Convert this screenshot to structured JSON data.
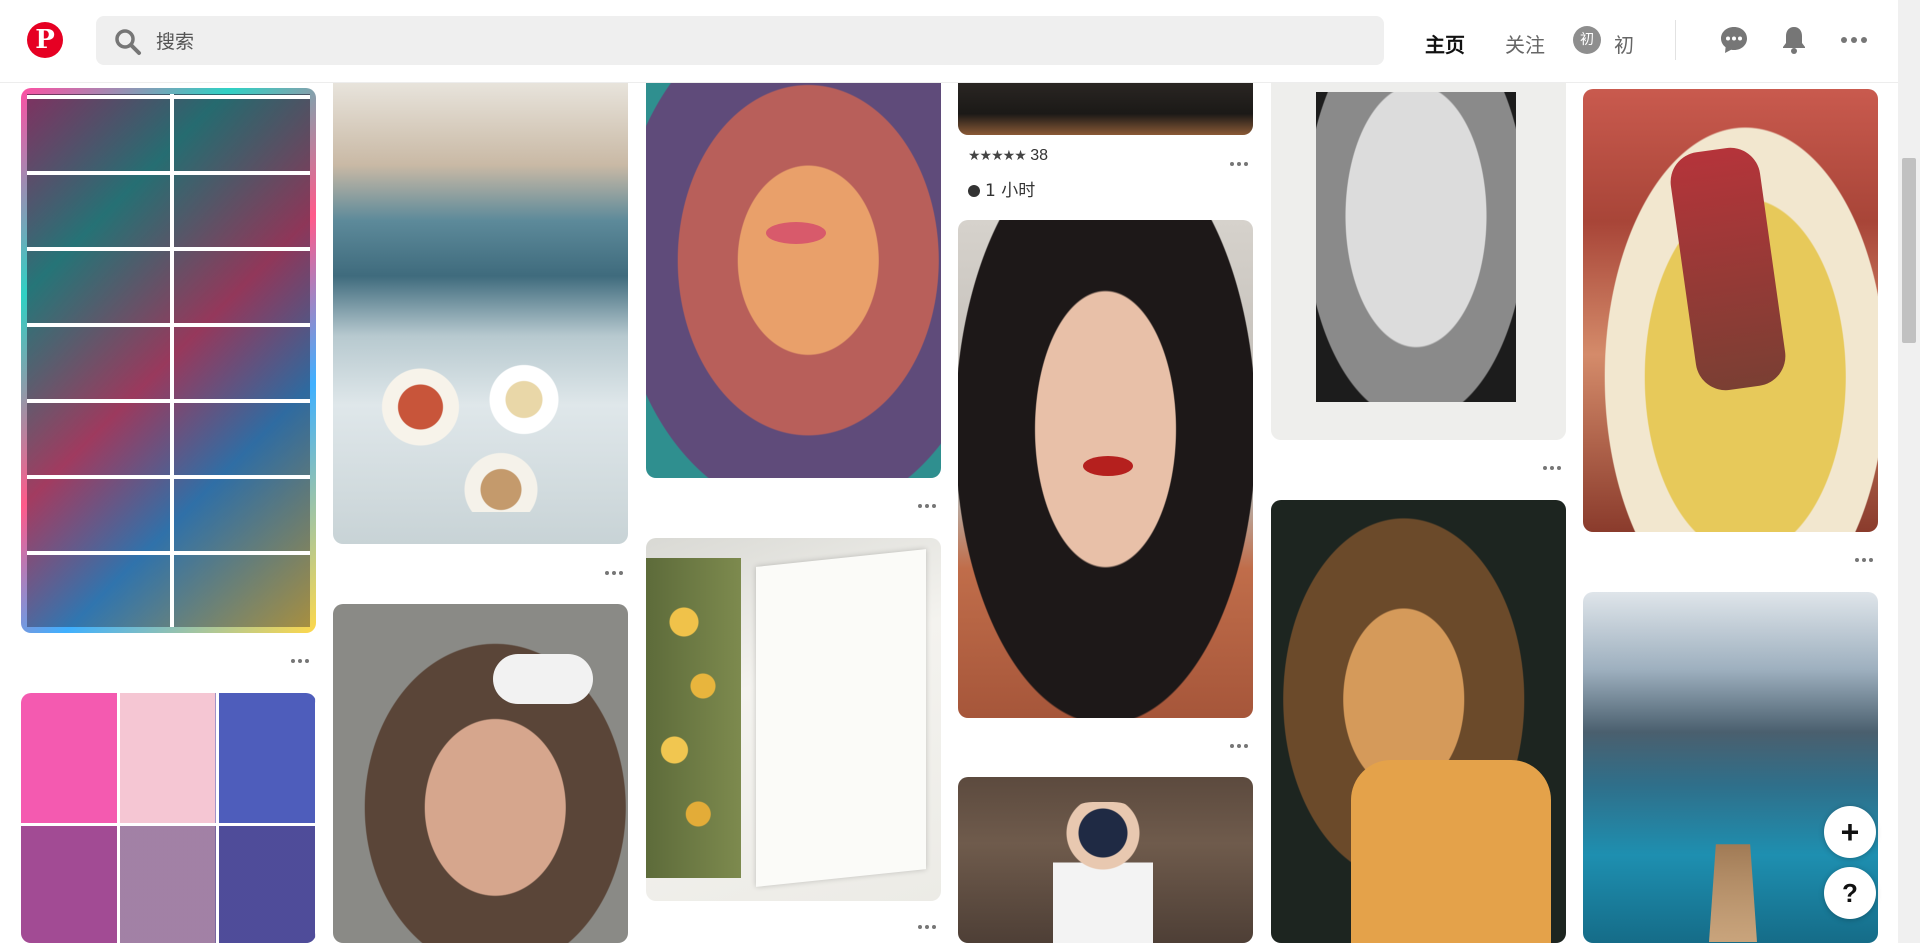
{
  "header": {
    "logo": "P",
    "search_placeholder": "搜索",
    "nav_home": "主页",
    "nav_following": "关注",
    "avatar_initial": "初",
    "username": "初"
  },
  "pins": {
    "rating_count": "38",
    "rating_stars": "★★★★★",
    "time_ago": "1 小时"
  },
  "fab": {
    "add": "+",
    "help": "?"
  },
  "colors": {
    "brand": "#e60023",
    "search_bg": "#efefef"
  },
  "icons": [
    "search-icon",
    "message-icon",
    "bell-icon",
    "more-icon",
    "clock-icon",
    "plus-icon",
    "help-icon"
  ]
}
